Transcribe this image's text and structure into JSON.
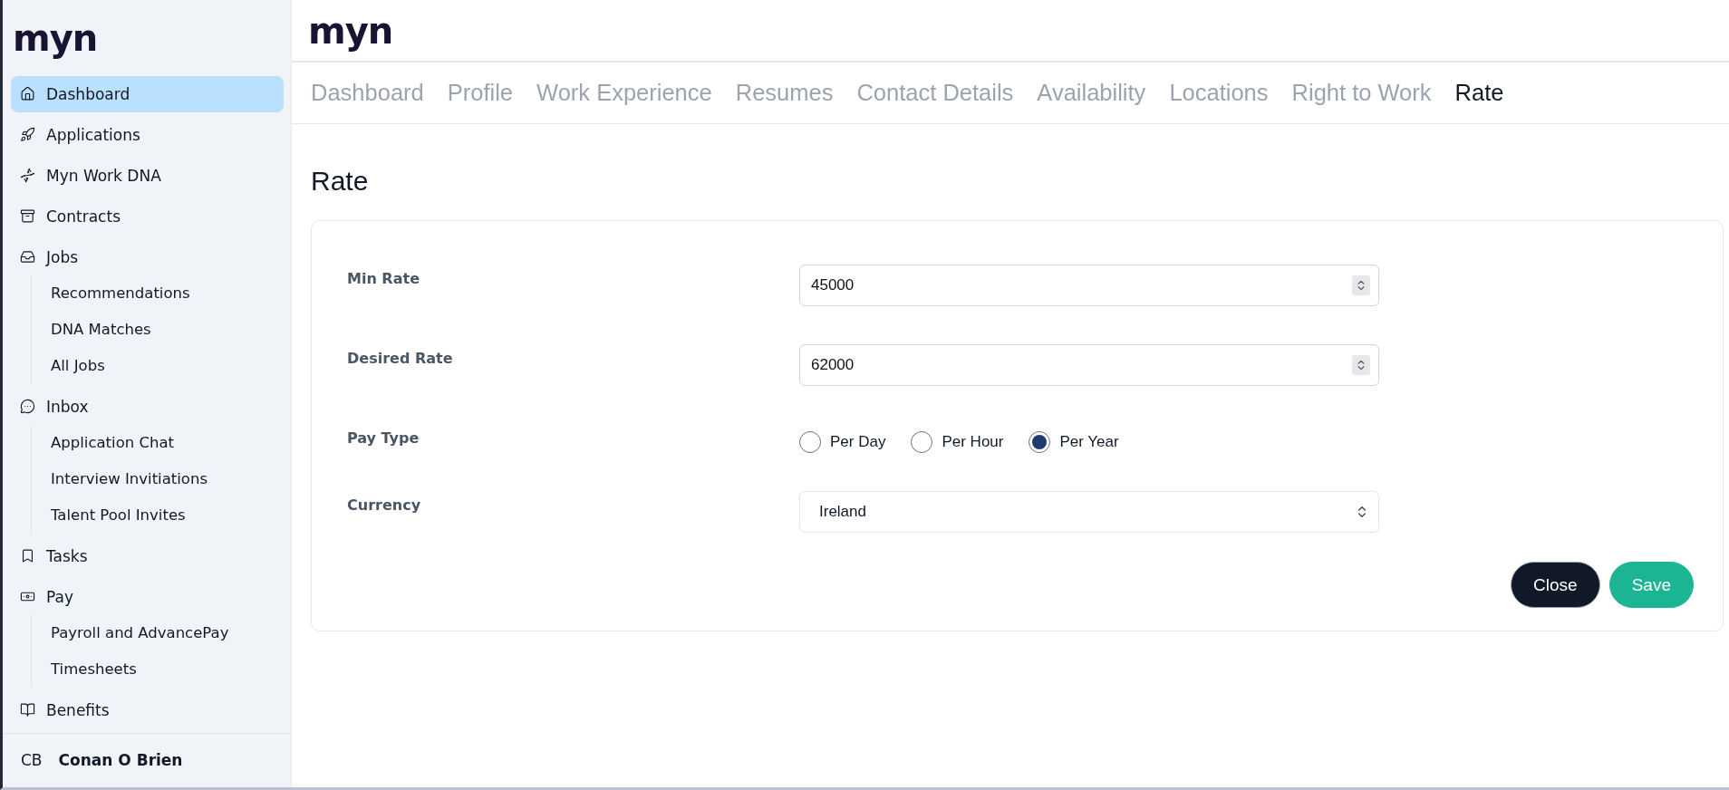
{
  "sidebar": {
    "logo": "myn",
    "items": [
      {
        "label": "Dashboard",
        "selected": true
      },
      {
        "label": "Applications",
        "selected": false
      },
      {
        "label": "Myn Work DNA",
        "selected": false
      },
      {
        "label": "Contracts",
        "selected": false
      },
      {
        "label": "Jobs",
        "selected": false,
        "children": [
          {
            "label": "Recommendations",
            "selected": false
          },
          {
            "label": "DNA Matches",
            "selected": false
          },
          {
            "label": "All Jobs",
            "selected": false
          }
        ]
      },
      {
        "label": "Inbox",
        "selected": false,
        "children": [
          {
            "label": "Application Chat",
            "selected": false
          },
          {
            "label": "Interview Invitiations",
            "selected": false
          },
          {
            "label": "Talent Pool Invites",
            "selected": false
          }
        ]
      },
      {
        "label": "Tasks",
        "selected": false
      },
      {
        "label": "Pay",
        "selected": false,
        "children": [
          {
            "label": "Payroll and AdvancePay",
            "selected": false
          },
          {
            "label": "Timesheets",
            "selected": false
          }
        ]
      },
      {
        "label": "Benefits",
        "selected": false
      }
    ],
    "user": {
      "initials": "CB",
      "name": "Conan O Brien"
    }
  },
  "header": {
    "logo": "myn"
  },
  "tabs": [
    {
      "label": "Dashboard",
      "selected": false
    },
    {
      "label": "Profile",
      "selected": false
    },
    {
      "label": "Work Experience",
      "selected": false
    },
    {
      "label": "Resumes",
      "selected": false
    },
    {
      "label": "Contact Details",
      "selected": false
    },
    {
      "label": "Availability",
      "selected": false
    },
    {
      "label": "Locations",
      "selected": false
    },
    {
      "label": "Right to Work",
      "selected": false
    },
    {
      "label": "Rate",
      "selected": true
    }
  ],
  "page_title": "Rate",
  "form": {
    "fields": [
      {
        "kind": "number",
        "label": "Min Rate",
        "value": "45000"
      },
      {
        "kind": "number",
        "label": "Desired Rate",
        "value": "62000"
      },
      {
        "kind": "radio",
        "label": "Pay Type",
        "options": [
          {
            "label": "Per Day",
            "selected": false
          },
          {
            "label": "Per Hour",
            "selected": false
          },
          {
            "label": "Per Year",
            "selected": true
          }
        ]
      },
      {
        "kind": "select",
        "label": "Currency",
        "value": "Ireland"
      }
    ],
    "buttons": [
      {
        "kind": "secondary",
        "label": "Close"
      },
      {
        "kind": "primary",
        "label": "Save"
      }
    ]
  }
}
